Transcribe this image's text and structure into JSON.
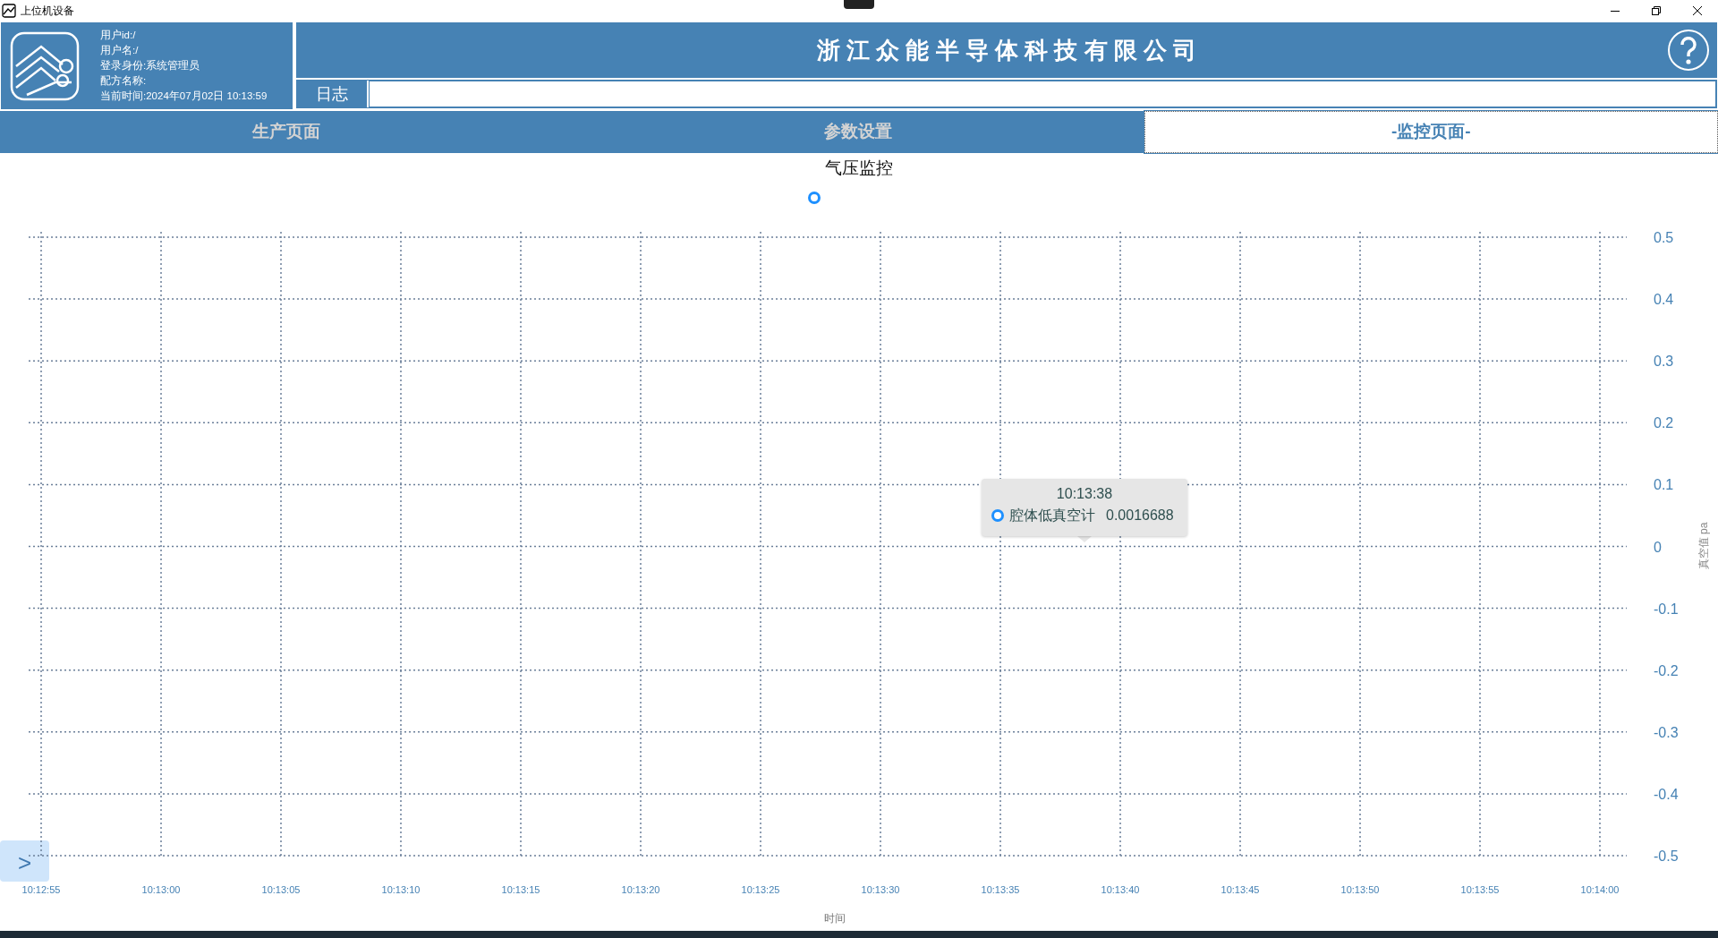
{
  "window": {
    "title": "上位机设备"
  },
  "user_info": [
    "用户id:/",
    "用户名:/",
    "登录身份:系统管理员",
    "配方名称:",
    "当前时间:2024年07月02日 10:13:59"
  ],
  "company": "浙 江 众 能 半 导 体 科 技 有 限 公 司",
  "log": {
    "label": "日志"
  },
  "tabs": [
    {
      "label": "生产页面",
      "selected": false
    },
    {
      "label": "参数设置",
      "selected": false
    },
    {
      "label": "-监控页面-",
      "selected": true
    }
  ],
  "legend": {
    "color": "#1e90ff"
  },
  "tooltip": {
    "title": "10:13:38",
    "series": "腔体低真空计",
    "value": "0.0016688",
    "color": "#1e90ff"
  },
  "side_toggle": ">",
  "chart_data": {
    "type": "line",
    "grid": true,
    "title": "气压监控",
    "xlabel": "时间",
    "ylabel": "真空值 pa",
    "ylim": [
      -0.5,
      0.5
    ],
    "categories": [
      "10:12:55",
      "10:13:00",
      "10:13:05",
      "10:13:10",
      "10:13:15",
      "10:13:20",
      "10:13:25",
      "10:13:30",
      "10:13:35",
      "10:13:40",
      "10:13:45",
      "10:13:50",
      "10:13:55",
      "10:14:00"
    ],
    "yticks": [
      {
        "value": 0.5,
        "label": "0.5"
      },
      {
        "value": 0.4,
        "label": "0.4"
      },
      {
        "value": 0.3,
        "label": "0.3"
      },
      {
        "value": 0.2,
        "label": "0.2"
      },
      {
        "value": 0.1,
        "label": "0.1"
      },
      {
        "value": 0,
        "label": "0"
      },
      {
        "value": -0.1,
        "label": "-0.1"
      },
      {
        "value": -0.2,
        "label": "-0.2"
      },
      {
        "value": -0.3,
        "label": "-0.3"
      },
      {
        "value": -0.4,
        "label": "-0.4"
      },
      {
        "value": -0.5,
        "label": "-0.5"
      }
    ]
  }
}
